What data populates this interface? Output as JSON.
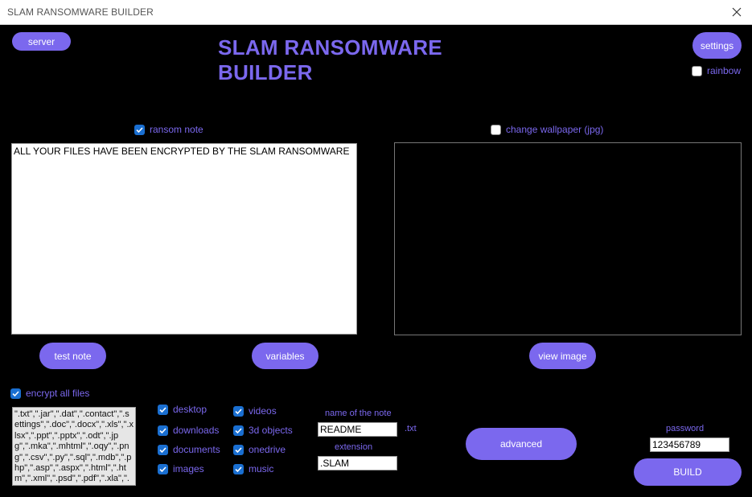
{
  "window": {
    "title": "SLAM RANSOMWARE BUILDER"
  },
  "header": {
    "app_title": "SLAM RANSOMWARE BUILDER",
    "server_label": "server",
    "settings_label": "settings",
    "rainbow_label": "rainbow",
    "rainbow_checked": false
  },
  "ransom_note": {
    "label": "ransom note",
    "checked": true,
    "text": "ALL YOUR FILES HAVE BEEN ENCRYPTED BY THE SLAM RANSOMWARE",
    "test_note_label": "test note",
    "variables_label": "variables"
  },
  "wallpaper": {
    "label": "change wallpaper (jpg)",
    "checked": false,
    "view_image_label": "view image"
  },
  "encryption": {
    "encrypt_all_label": "encrypt all files",
    "encrypt_all_checked": true,
    "extensions_text": "\".txt\",\".jar\",\".dat\",\".contact\",\".settings\",\".doc\",\".docx\",\".xls\",\".xlsx\",\".ppt\",\".pptx\",\".odt\",\".jpg\",\".mka\",\".mhtml\",\".oqy\",\".png\",\".csv\",\".py\",\".sql\",\".mdb\",\".php\",\".asp\",\".aspx\",\".html\",\".htm\",\".xml\",\".psd\",\".pdf\",\".xla\",\".cu"
  },
  "folders": {
    "col1": [
      {
        "label": "desktop",
        "checked": true
      },
      {
        "label": "downloads",
        "checked": true
      },
      {
        "label": "documents",
        "checked": true
      },
      {
        "label": "images",
        "checked": true
      }
    ],
    "col2": [
      {
        "label": "videos",
        "checked": true
      },
      {
        "label": "3d objects",
        "checked": true
      },
      {
        "label": "onedrive",
        "checked": true
      },
      {
        "label": "music",
        "checked": true
      }
    ]
  },
  "note_settings": {
    "name_label": "name of the note",
    "name_value": "README",
    "name_suffix": ".txt",
    "extension_label": "extension",
    "extension_value": ".SLAM"
  },
  "build": {
    "advanced_label": "advanced",
    "password_label": "password",
    "password_value": "123456789",
    "build_label": "BUILD"
  },
  "colors": {
    "accent": "#7b68ee",
    "checkbox_on": "#1a6fd1",
    "background": "#000000"
  }
}
